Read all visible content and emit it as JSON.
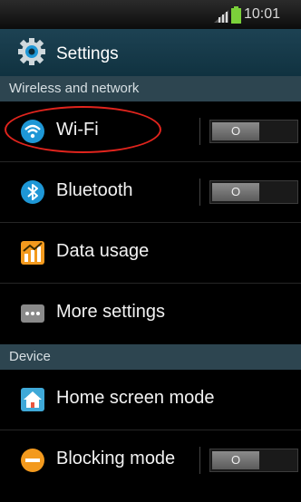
{
  "status_bar": {
    "time": "10:01"
  },
  "header": {
    "title": "Settings"
  },
  "sections": {
    "wireless": "Wireless and network",
    "device": "Device"
  },
  "rows": {
    "wifi": {
      "label": "Wi-Fi",
      "toggle": "O",
      "icon": "wifi-icon"
    },
    "bluetooth": {
      "label": "Bluetooth",
      "toggle": "O",
      "icon": "bluetooth-icon"
    },
    "data_usage": {
      "label": "Data usage",
      "icon": "data-usage-icon"
    },
    "more_settings": {
      "label": "More settings",
      "icon": "more-icon"
    },
    "home_screen_mode": {
      "label": "Home screen mode",
      "icon": "home-icon"
    },
    "blocking_mode": {
      "label": "Blocking mode",
      "toggle": "O",
      "icon": "blocking-icon"
    }
  },
  "colors": {
    "accent": "#1e97d6",
    "highlight": "#e0241d",
    "section_header_bg": "#2d4550"
  }
}
